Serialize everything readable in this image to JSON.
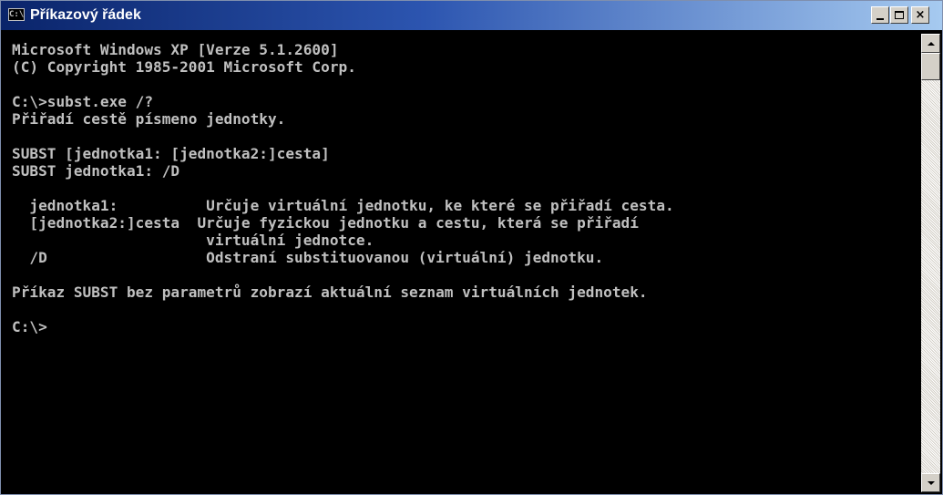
{
  "window": {
    "title": "Příkazový řádek",
    "icon_label": "C:\\",
    "controls": {
      "minimize": "minimize",
      "maximize": "maximize",
      "close": "×"
    }
  },
  "console": {
    "lines": [
      "Microsoft Windows XP [Verze 5.1.2600]",
      "(C) Copyright 1985-2001 Microsoft Corp.",
      "",
      "C:\\>subst.exe /?",
      "Přiřadí cestě písmeno jednotky.",
      "",
      "SUBST [jednotka1: [jednotka2:]cesta]",
      "SUBST jednotka1: /D",
      "",
      "  jednotka1:          Určuje virtuální jednotku, ke které se přiřadí cesta.",
      "  [jednotka2:]cesta  Určuje fyzickou jednotku a cestu, která se přiřadí",
      "                      virtuální jednotce.",
      "  /D                  Odstraní substituovanou (virtuální) jednotku.",
      "",
      "Příkaz SUBST bez parametrů zobrazí aktuální seznam virtuálních jednotek.",
      "",
      "C:\\>"
    ]
  },
  "colors": {
    "console_bg": "#000000",
    "console_text": "#c0c0c0",
    "titlebar_start": "#0a246a",
    "titlebar_end": "#a6caf0"
  },
  "icons": [
    "console-app-icon",
    "minimize-icon",
    "maximize-icon",
    "close-icon",
    "scroll-up-arrow-icon",
    "scroll-down-arrow-icon"
  ]
}
